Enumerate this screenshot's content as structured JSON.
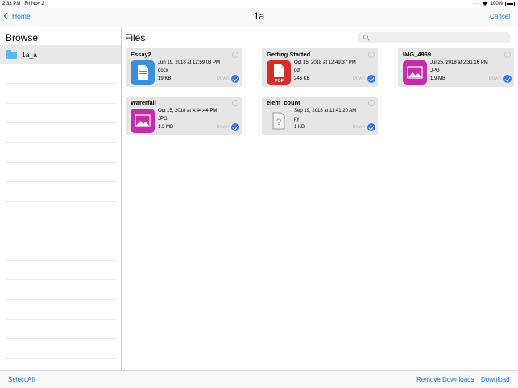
{
  "status": {
    "time": "2:33 PM",
    "date": "Fri Nov 2",
    "battery": "100%"
  },
  "nav": {
    "back": "Home",
    "title": "1a",
    "cancel": "Cancel"
  },
  "sidebar": {
    "title": "Browse",
    "folder": "1a_a"
  },
  "main": {
    "title": "Files",
    "search_placeholder": ""
  },
  "files": [
    {
      "name": "Essay2",
      "date": "Jun 19, 2018 at 12:59:03 PM",
      "type": "docx",
      "size": "19 KB",
      "download_label": "Down",
      "thumb": "doc-icon"
    },
    {
      "name": "Getting Started",
      "date": "Oct 15, 2018 at 12:49:37 PM",
      "type": "pdf",
      "size": "246 KB",
      "download_label": "Down",
      "thumb": "pdf-icon"
    },
    {
      "name": "IMG_4969",
      "date": "Jul 25, 2018 at 2:31:16 PM",
      "type": "JPG",
      "size": "1.9 MB",
      "download_label": "Down",
      "thumb": "image-icon"
    },
    {
      "name": "Warerfall",
      "date": "Oct 15, 2018 at 4:44:44 PM",
      "type": "JPG",
      "size": "1.3 MB",
      "download_label": "Down",
      "thumb": "image-icon"
    },
    {
      "name": "elem_count",
      "date": "Sep 19, 2018 at 11:41:20 AM",
      "type": "py",
      "size": "1 KB",
      "download_label": "Down",
      "thumb": "unknown-file-icon"
    }
  ],
  "toolbar": {
    "select_all": "Select All",
    "remove_downloads": "Remove Downloads",
    "download": "Download"
  }
}
